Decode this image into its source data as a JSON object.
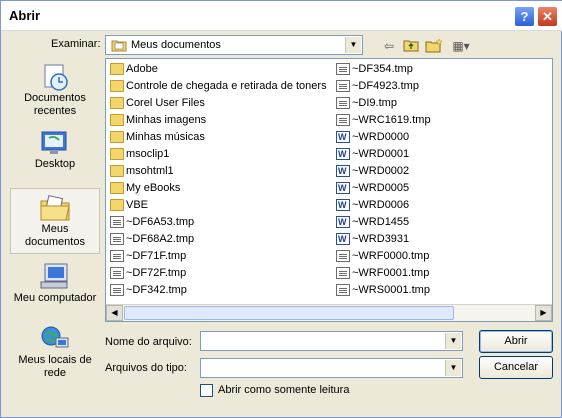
{
  "window": {
    "title": "Abrir",
    "help_label": "?",
    "close_label": "✕"
  },
  "lookin": {
    "label": "Examinar:",
    "value": "Meus documentos",
    "dropdown_glyph": "▼"
  },
  "toolbar": {
    "back_glyph": "⇦",
    "up_glyph": "⇧",
    "newfolder_glyph": "✱",
    "views_glyph": "▦▾"
  },
  "places": [
    {
      "label": "Documentos recentes",
      "icon": "recent-documents-icon"
    },
    {
      "label": "Desktop",
      "icon": "desktop-icon"
    },
    {
      "label": "Meus documentos",
      "icon": "my-documents-icon",
      "selected": true
    },
    {
      "label": "Meu computador",
      "icon": "my-computer-icon"
    },
    {
      "label": "Meus locais de rede",
      "icon": "network-places-icon"
    }
  ],
  "files": {
    "column1": [
      {
        "name": "Adobe",
        "type": "folder"
      },
      {
        "name": "Controle de chegada e retirada de toners",
        "type": "folder"
      },
      {
        "name": "Corel User Files",
        "type": "folder"
      },
      {
        "name": "Minhas imagens",
        "type": "folder"
      },
      {
        "name": "Minhas músicas",
        "type": "folder"
      },
      {
        "name": "msoclip1",
        "type": "folder"
      },
      {
        "name": "msohtml1",
        "type": "folder"
      },
      {
        "name": "My eBooks",
        "type": "folder"
      },
      {
        "name": "VBE",
        "type": "folder"
      },
      {
        "name": "~DF6A53.tmp",
        "type": "tmp"
      },
      {
        "name": "~DF68A2.tmp",
        "type": "tmp"
      },
      {
        "name": "~DF71F.tmp",
        "type": "tmp"
      },
      {
        "name": "~DF72F.tmp",
        "type": "tmp"
      },
      {
        "name": "~DF342.tmp",
        "type": "tmp"
      }
    ],
    "column2": [
      {
        "name": "~DF354.tmp",
        "type": "tmp"
      },
      {
        "name": "~DF4923.tmp",
        "type": "tmp"
      },
      {
        "name": "~DI9.tmp",
        "type": "tmp"
      },
      {
        "name": "~WRC1619.tmp",
        "type": "tmp"
      },
      {
        "name": "~WRD0000",
        "type": "doc"
      },
      {
        "name": "~WRD0001",
        "type": "doc"
      },
      {
        "name": "~WRD0002",
        "type": "doc"
      },
      {
        "name": "~WRD0005",
        "type": "doc"
      },
      {
        "name": "~WRD0006",
        "type": "doc"
      },
      {
        "name": "~WRD1455",
        "type": "doc"
      },
      {
        "name": "~WRD3931",
        "type": "doc"
      },
      {
        "name": "~WRF0000.tmp",
        "type": "tmp"
      },
      {
        "name": "~WRF0001.tmp",
        "type": "tmp"
      },
      {
        "name": "~WRS0001.tmp",
        "type": "tmp"
      }
    ]
  },
  "scroll": {
    "left_glyph": "◀",
    "right_glyph": "▶"
  },
  "form": {
    "filename_label": "Nome do arquivo:",
    "filename_value": "",
    "filetype_label": "Arquivos do tipo:",
    "filetype_value": "",
    "dropdown_glyph": "▼",
    "readonly_label": "Abrir como somente leitura"
  },
  "buttons": {
    "open": "Abrir",
    "cancel": "Cancelar"
  }
}
